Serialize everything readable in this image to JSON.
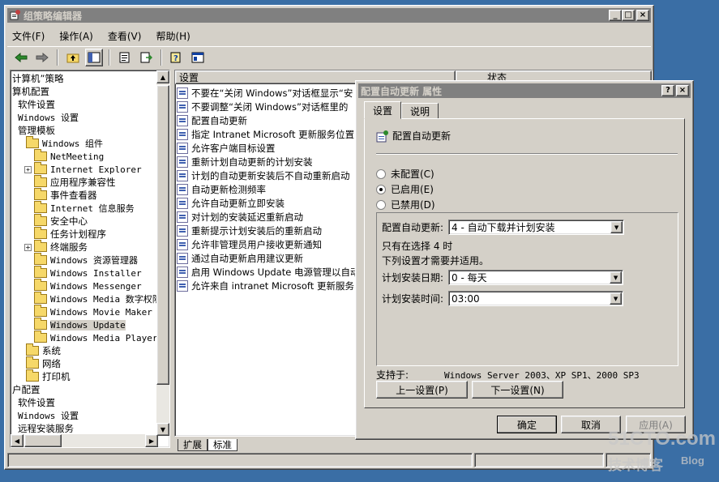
{
  "main": {
    "title": "组策略编辑器",
    "window_buttons": {
      "minimize": "_",
      "maximize": "□",
      "close": "×"
    },
    "menus": [
      "文件(F)",
      "操作(A)",
      "查看(V)",
      "帮助(H)"
    ],
    "toolbar_icons": [
      "back-arrow-icon",
      "forward-arrow-icon",
      "up-folder-icon",
      "show-tree-icon",
      "properties-icon",
      "export-list-icon",
      "help-icon",
      "show-pane-icon"
    ]
  },
  "tree": {
    "items": [
      {
        "label": "计算机”策略",
        "indent": 0,
        "folder": false,
        "mono": false
      },
      {
        "label": "算机配置",
        "indent": 0,
        "folder": false,
        "mono": false
      },
      {
        "label": "软件设置",
        "indent": 1,
        "folder": false,
        "mono": false
      },
      {
        "label": "Windows 设置",
        "indent": 1,
        "folder": false,
        "mono": true
      },
      {
        "label": "管理模板",
        "indent": 1,
        "folder": false,
        "mono": false
      },
      {
        "label": "Windows 组件",
        "indent": 2,
        "folder": true,
        "mono": true
      },
      {
        "label": "NetMeeting",
        "indent": 3,
        "folder": true,
        "mono": true
      },
      {
        "label": "Internet Explorer",
        "indent": 3,
        "folder": true,
        "mono": true,
        "plus": true
      },
      {
        "label": "应用程序兼容性",
        "indent": 3,
        "folder": true,
        "mono": false
      },
      {
        "label": "事件查看器",
        "indent": 3,
        "folder": true,
        "mono": false
      },
      {
        "label": "Internet 信息服务",
        "indent": 3,
        "folder": true,
        "mono": true
      },
      {
        "label": "安全中心",
        "indent": 3,
        "folder": true,
        "mono": false
      },
      {
        "label": "任务计划程序",
        "indent": 3,
        "folder": true,
        "mono": false
      },
      {
        "label": "终端服务",
        "indent": 3,
        "folder": true,
        "mono": false,
        "plus": true
      },
      {
        "label": "Windows 资源管理器",
        "indent": 3,
        "folder": true,
        "mono": true
      },
      {
        "label": "Windows Installer",
        "indent": 3,
        "folder": true,
        "mono": true
      },
      {
        "label": "Windows Messenger",
        "indent": 3,
        "folder": true,
        "mono": true
      },
      {
        "label": "Windows Media 数字权限",
        "indent": 3,
        "folder": true,
        "mono": true
      },
      {
        "label": "Windows Movie Maker",
        "indent": 3,
        "folder": true,
        "mono": true
      },
      {
        "label": "Windows Update",
        "indent": 3,
        "folder": true,
        "mono": true,
        "selected": true
      },
      {
        "label": "Windows Media Player",
        "indent": 3,
        "folder": true,
        "mono": true
      },
      {
        "label": "系统",
        "indent": 2,
        "folder": true,
        "mono": false
      },
      {
        "label": "网络",
        "indent": 2,
        "folder": true,
        "mono": false
      },
      {
        "label": "打印机",
        "indent": 2,
        "folder": true,
        "mono": false
      },
      {
        "label": "户配置",
        "indent": 0,
        "folder": false,
        "mono": false
      },
      {
        "label": "软件设置",
        "indent": 1,
        "folder": false,
        "mono": false
      },
      {
        "label": "Windows 设置",
        "indent": 1,
        "folder": false,
        "mono": true
      },
      {
        "label": "远程安装服务",
        "indent": 1,
        "folder": false,
        "mono": false
      }
    ]
  },
  "list": {
    "columns": [
      "设置",
      "状态"
    ],
    "rows": [
      "不要在“关闭 Windows”对话框显示“安",
      "不要调整“关闭 Windows”对话框里的",
      "配置自动更新",
      "指定 Intranet Microsoft 更新服务位置",
      "允许客户端目标设置",
      "重新计划自动更新的计划安装",
      "计划的自动更新安装后不自动重新启动",
      "自动更新检测频率",
      "允许自动更新立即安装",
      "对计划的安装延迟重新启动",
      "重新提示计划安装后的重新启动",
      "允许非管理员用户接收更新通知",
      "通过自动更新启用建议更新",
      "启用 Windows Update 电源管理以自动唤",
      "允许来自 intranet Microsoft 更新服务"
    ],
    "bottom_tabs": [
      "扩展",
      "标准"
    ]
  },
  "dialog": {
    "title": "配置自动更新 属性",
    "title_buttons": [
      "?",
      "×"
    ],
    "tabs": [
      "设置",
      "说明"
    ],
    "policy_name": "配置自动更新",
    "radios": [
      {
        "label": "未配置(C)",
        "checked": false
      },
      {
        "label": "已启用(E)",
        "checked": true
      },
      {
        "label": "已禁用(D)",
        "checked": false
      }
    ],
    "configure_label": "配置自动更新:",
    "configure_value": "4 - 自动下载并计划安装",
    "note_line1": "只有在选择 4 时",
    "note_line2": "下列设置才需要并适用。",
    "day_label": "计划安装日期:",
    "day_value": "0 - 每天",
    "time_label": "计划安装时间:",
    "time_value": "03:00",
    "supported_label": "支持于:",
    "supported_value": "Windows Server 2003、XP SP1、2000 SP3",
    "prev_button": "上一设置(P)",
    "next_button": "下一设置(N)",
    "ok_button": "确定",
    "cancel_button": "取消",
    "apply_button": "应用(A)"
  },
  "watermark": {
    "line1": "51CTO.com",
    "line2": "技术博客",
    "line3": "Blog"
  }
}
